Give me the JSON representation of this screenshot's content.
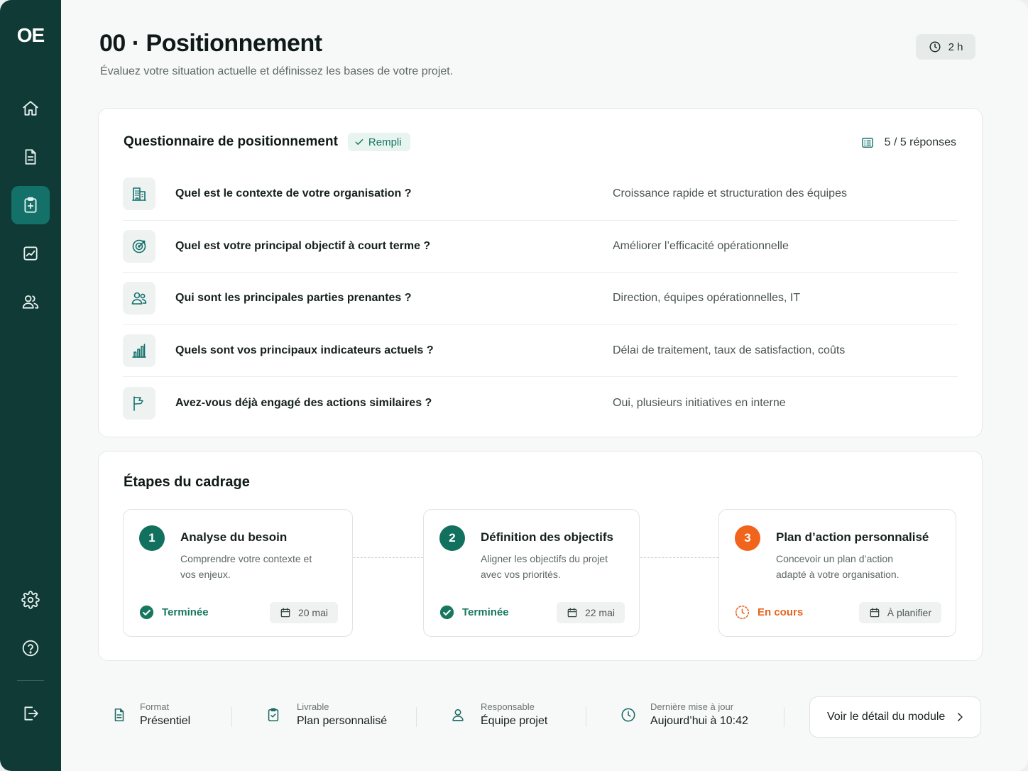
{
  "brand": {
    "logo": "OE"
  },
  "sidebar": {
    "items": [
      {
        "name": "home",
        "icon": "home-icon",
        "active": false
      },
      {
        "name": "documents",
        "icon": "document-icon",
        "active": false
      },
      {
        "name": "positioning",
        "icon": "clipboard-icon",
        "active": true
      },
      {
        "name": "analytics",
        "icon": "chart-icon",
        "active": false
      },
      {
        "name": "team",
        "icon": "users-icon",
        "active": false
      }
    ],
    "bottom": [
      {
        "name": "settings",
        "icon": "gear-icon"
      },
      {
        "name": "help",
        "icon": "help-icon"
      },
      {
        "name": "logout",
        "icon": "logout-icon"
      }
    ]
  },
  "header": {
    "title": "00 · Positionnement",
    "subtitle": "Évaluez votre situation actuelle et définissez les bases de votre projet.",
    "duration": "2 h"
  },
  "questionnaire": {
    "title": "Questionnaire de positionnement",
    "status": "Rempli",
    "count": "5 / 5 réponses",
    "rows": [
      {
        "icon": "building-icon",
        "question": "Quel est le contexte de votre organisation ?",
        "answer": "Croissance rapide et structuration des équipes"
      },
      {
        "icon": "target-icon",
        "question": "Quel est votre principal objectif à court terme ?",
        "answer": "Améliorer l’efficacité opérationnelle"
      },
      {
        "icon": "users-icon",
        "question": "Qui sont les principales parties prenantes ?",
        "answer": "Direction, équipes opérationnelles, IT"
      },
      {
        "icon": "bar-chart-icon",
        "question": "Quels sont vos principaux indicateurs actuels ?",
        "answer": "Délai de traitement, taux de satisfaction, coûts"
      },
      {
        "icon": "flag-icon",
        "question": "Avez-vous déjà engagé des actions similaires ?",
        "answer": "Oui, plusieurs initiatives en interne"
      }
    ]
  },
  "steps": {
    "title": "Étapes du cadrage",
    "items": [
      {
        "number": "1",
        "title": "Analyse du besoin",
        "description": "Comprendre votre contexte et vos enjeux.",
        "status": "Terminée",
        "date": "20 mai"
      },
      {
        "number": "2",
        "title": "Définition des objectifs",
        "description": "Aligner les objectifs du projet avec vos priorités.",
        "status": "Terminée",
        "date": "22 mai"
      },
      {
        "number": "3",
        "title": "Plan d’action personnalisé",
        "description": "Concevoir un plan d’action adapté à votre organisation.",
        "status": "En cours",
        "date": "À planifier"
      }
    ]
  },
  "footer": {
    "items": [
      {
        "label": "Format",
        "value": "Présentiel",
        "icon": "document-icon"
      },
      {
        "label": "Livrable",
        "value": "Plan personnalisé",
        "icon": "clipboard-icon"
      },
      {
        "label": "Responsable",
        "value": "Équipe projet",
        "icon": "user-icon"
      },
      {
        "label": "Dernière mise à jour",
        "value": "Aujourd’hui à 10:42",
        "icon": "clock-icon"
      }
    ],
    "detail_button": "Voir le détail du module"
  },
  "colors": {
    "sidebar": "#0f3a36",
    "accent": "#14716a",
    "done": "#18785f",
    "in_progress": "#f0641c"
  }
}
